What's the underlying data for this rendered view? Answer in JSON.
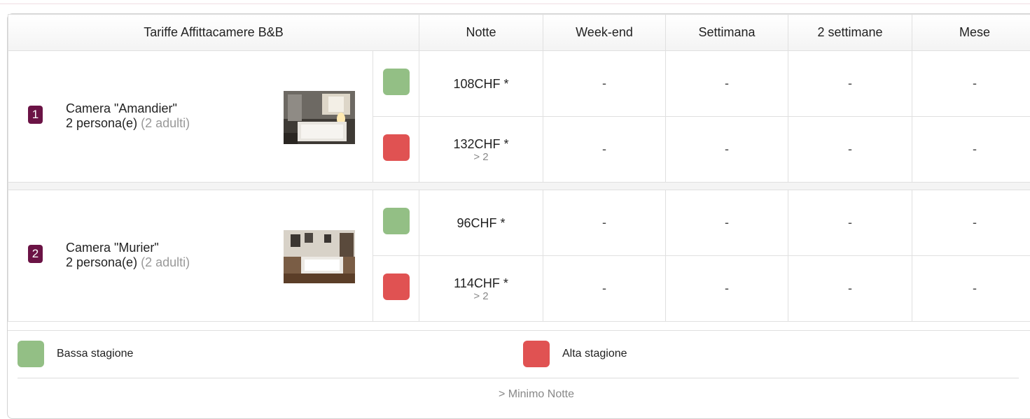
{
  "table": {
    "headers": [
      "Tariffe Affittacamere B&B",
      "Notte",
      "Week-end",
      "Settimana",
      "2 settimane",
      "Mese"
    ],
    "rooms": [
      {
        "number": "1",
        "name": "Camera \"Amandier\"",
        "capacity": "2 persona(e)",
        "adults": "(2 adulti)",
        "rates": [
          {
            "season": "low",
            "price": "108CHF *",
            "min_nights": "",
            "weekend": "-",
            "week": "-",
            "two_weeks": "-",
            "month": "-"
          },
          {
            "season": "high",
            "price": "132CHF *",
            "min_nights": "> 2",
            "weekend": "-",
            "week": "-",
            "two_weeks": "-",
            "month": "-"
          }
        ]
      },
      {
        "number": "2",
        "name": "Camera \"Murier\"",
        "capacity": "2 persona(e)",
        "adults": "(2 adulti)",
        "rates": [
          {
            "season": "low",
            "price": "96CHF *",
            "min_nights": "",
            "weekend": "-",
            "week": "-",
            "two_weeks": "-",
            "month": "-"
          },
          {
            "season": "high",
            "price": "114CHF *",
            "min_nights": "> 2",
            "weekend": "-",
            "week": "-",
            "two_weeks": "-",
            "month": "-"
          }
        ]
      }
    ]
  },
  "legend": {
    "low_label": "Bassa stagione",
    "high_label": "Alta stagione",
    "note": "> Minimo Notte"
  },
  "colors": {
    "low_season": "#93bf85",
    "high_season": "#e05252",
    "room_badge": "#6b1345"
  }
}
